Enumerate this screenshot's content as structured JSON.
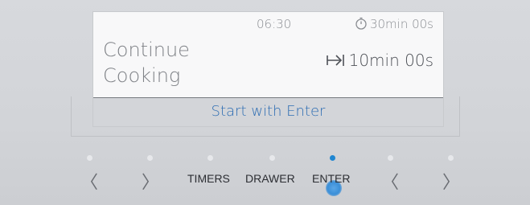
{
  "screen": {
    "clock": "06:30",
    "timer_remaining": "30min 00s",
    "program_title_line1": "Continue",
    "program_title_line2": "Cooking",
    "duration": "10min 00s",
    "action_text": "Start with Enter"
  },
  "controls": {
    "left1": "〈",
    "right1": "〉",
    "timers": "TIMERS",
    "drawer": "DRAWER",
    "enter": "ENTER",
    "left2": "〈",
    "right2": "〉"
  },
  "indicators": {
    "active_index": 4,
    "active_color": "#1f86d1",
    "inactive_color": "#e7e8eb"
  },
  "icons": {
    "timer": "stopwatch-icon",
    "duration": "skip-to-end-icon"
  }
}
